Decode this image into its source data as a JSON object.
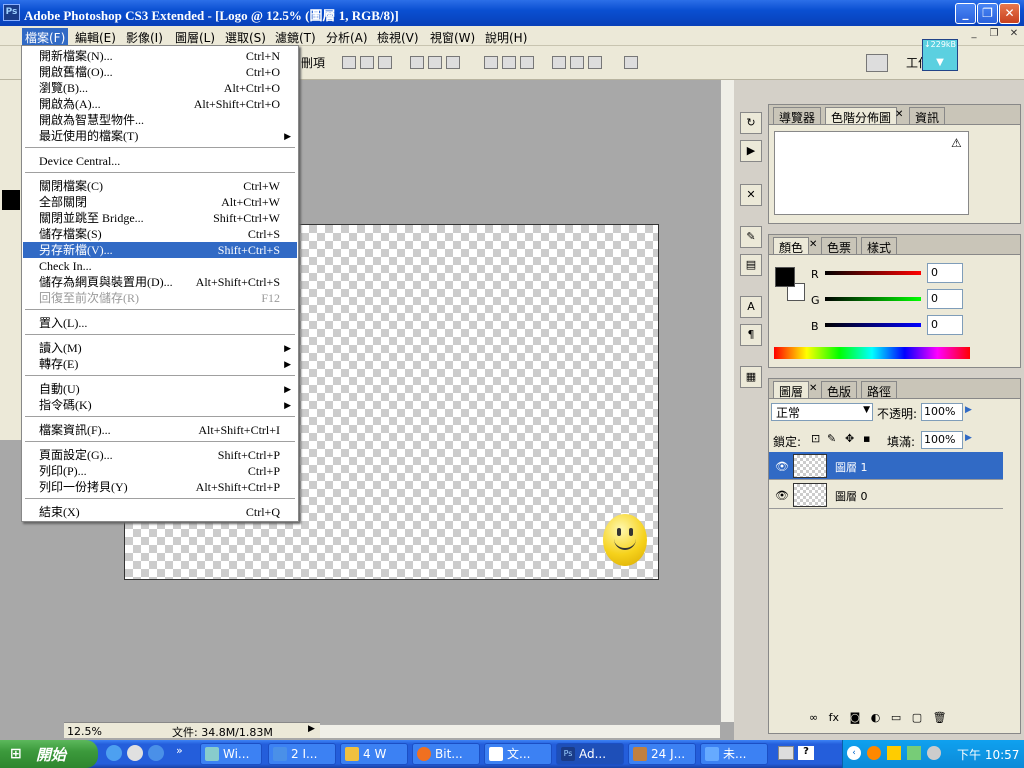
{
  "app": {
    "title": "Adobe Photoshop CS3 Extended - [Logo @ 12.5% (圖層 1, RGB/8)]",
    "icon": "Ps"
  },
  "menubar": [
    "檔案(F)",
    "編輯(E)",
    "影像(I)",
    "圖層(L)",
    "選取(S)",
    "濾鏡(T)",
    "分析(A)",
    "檢視(V)",
    "視窗(W)",
    "說明(H)"
  ],
  "optbar": {
    "crop_label": "刪項",
    "workspace": "工作區",
    "speed": "↓229kB"
  },
  "file_menu": [
    {
      "label": "開新檔案(N)...",
      "shortcut": "Ctrl+N"
    },
    {
      "label": "開啟舊檔(O)...",
      "shortcut": "Ctrl+O"
    },
    {
      "label": "瀏覽(B)...",
      "shortcut": "Alt+Ctrl+O"
    },
    {
      "label": "開啟為(A)...",
      "shortcut": "Alt+Shift+Ctrl+O"
    },
    {
      "label": "開啟為智慧型物件...",
      "shortcut": ""
    },
    {
      "label": "最近使用的檔案(T)",
      "shortcut": "",
      "submenu": true
    },
    {
      "label": "Device Central...",
      "shortcut": ""
    },
    {
      "label": "關閉檔案(C)",
      "shortcut": "Ctrl+W"
    },
    {
      "label": "全部關閉",
      "shortcut": "Alt+Ctrl+W"
    },
    {
      "label": "關閉並跳至 Bridge...",
      "shortcut": "Shift+Ctrl+W"
    },
    {
      "label": "儲存檔案(S)",
      "shortcut": "Ctrl+S"
    },
    {
      "label": "另存新檔(V)...",
      "shortcut": "Shift+Ctrl+S",
      "highlighted": true
    },
    {
      "label": "Check In...",
      "shortcut": ""
    },
    {
      "label": "儲存為網頁與裝置用(D)...",
      "shortcut": "Alt+Shift+Ctrl+S"
    },
    {
      "label": "回復至前次儲存(R)",
      "shortcut": "F12",
      "disabled": true
    },
    {
      "label": "置入(L)...",
      "shortcut": ""
    },
    {
      "label": "讀入(M)",
      "shortcut": "",
      "submenu": true
    },
    {
      "label": "轉存(E)",
      "shortcut": "",
      "submenu": true
    },
    {
      "label": "自動(U)",
      "shortcut": "",
      "submenu": true
    },
    {
      "label": "指令碼(K)",
      "shortcut": "",
      "submenu": true
    },
    {
      "label": "檔案資訊(F)...",
      "shortcut": "Alt+Shift+Ctrl+I"
    },
    {
      "label": "頁面設定(G)...",
      "shortcut": "Shift+Ctrl+P"
    },
    {
      "label": "列印(P)...",
      "shortcut": "Ctrl+P"
    },
    {
      "label": "列印一份拷貝(Y)",
      "shortcut": "Alt+Shift+Ctrl+P"
    },
    {
      "label": "結束(X)",
      "shortcut": "Ctrl+Q"
    }
  ],
  "status": {
    "zoom": "12.5%",
    "doc": "文件: 34.8M/1.83M"
  },
  "panels": {
    "nav_tabs": [
      "導覽器",
      "色階分佈圖",
      "資訊"
    ],
    "color_tabs": [
      "顏色",
      "色票",
      "樣式"
    ],
    "color": {
      "r_label": "R",
      "g_label": "G",
      "b_label": "B",
      "r": "0",
      "g": "0",
      "b": "0"
    },
    "layer_tabs": [
      "圖層",
      "色版",
      "路徑"
    ],
    "blend_mode": "正常",
    "opacity_label": "不透明:",
    "opacity": "100%",
    "lock_label": "鎖定:",
    "fill_label": "填滿:",
    "fill": "100%",
    "layers": [
      {
        "name": "圖層 1",
        "selected": true
      },
      {
        "name": "圖層 0",
        "selected": false
      }
    ]
  },
  "taskbar": {
    "start": "開始",
    "buttons": [
      "Wi...",
      "2 I...",
      "4 W",
      "Bit...",
      "文...",
      "Ad...",
      "24 J...",
      "未..."
    ],
    "clock": "下午 10:57"
  }
}
